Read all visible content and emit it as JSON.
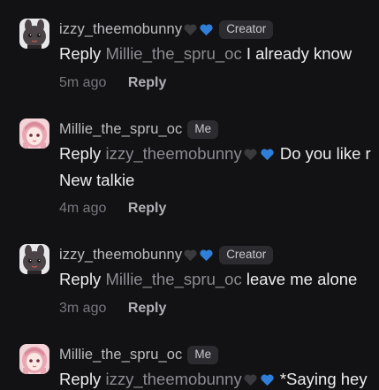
{
  "colors": {
    "background": "#121214",
    "username": "#bdbdc3",
    "mention": "#8b8b92",
    "badge_bg": "#2c2c30",
    "black_heart": "#3a3a3e",
    "blue_heart": "#2f7fd8"
  },
  "comments": [
    {
      "username": "izzy_theemobunny",
      "hearts": [
        "black-heart-icon",
        "blue-heart-icon"
      ],
      "badge": "Creator",
      "reply_word": "Reply",
      "mention": "Millie_the_spru_oc",
      "text": "I already know",
      "time": "5m ago",
      "reply_action": "Reply"
    },
    {
      "username": "Millie_the_spru_oc",
      "badge": "Me",
      "reply_word": "Reply",
      "mention": "izzy_theemobunny",
      "mention_hearts": [
        "black-heart-icon",
        "blue-heart-icon"
      ],
      "text": "Do you like r",
      "text2": "New talkie",
      "time": "4m ago",
      "reply_action": "Reply"
    },
    {
      "username": "izzy_theemobunny",
      "hearts": [
        "black-heart-icon",
        "blue-heart-icon"
      ],
      "badge": "Creator",
      "reply_word": "Reply",
      "mention": "Millie_the_spru_oc",
      "text": "leave me alone",
      "time": "3m ago",
      "reply_action": "Reply"
    },
    {
      "username": "Millie_the_spru_oc",
      "badge": "Me",
      "reply_word": "Reply",
      "mention": "izzy_theemobunny",
      "mention_hearts": [
        "black-heart-icon",
        "blue-heart-icon"
      ],
      "text": "*Saying hey"
    }
  ]
}
